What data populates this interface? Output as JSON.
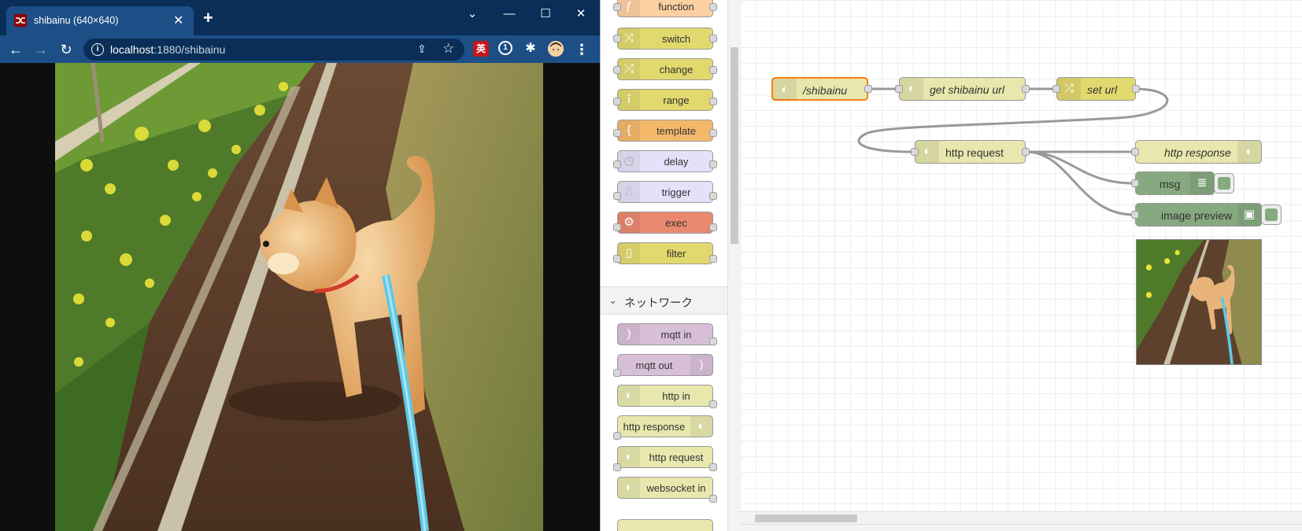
{
  "browser": {
    "tab": {
      "title": "shibainu (640×640)",
      "close": "✕",
      "new_tab": "+"
    },
    "window": {
      "minimize": "—",
      "maximize": "☐",
      "close": "✕",
      "menu": "⌄"
    },
    "toolbar": {
      "back": "←",
      "forward": "→",
      "reload": "↻",
      "url_host": "localhost",
      "url_path": ":1880/shibainu",
      "ext_translate": "英",
      "menu": "⋮"
    },
    "content": {
      "image_subject": "shiba-inu-dog-photo"
    }
  },
  "palette": {
    "category_network": "ネットワーク",
    "nodes_function": [
      {
        "label": "function",
        "icon": "function-icon",
        "color": "#fdd0a2"
      },
      {
        "label": "switch",
        "icon": "switch-icon",
        "color": "#e2d96e"
      },
      {
        "label": "change",
        "icon": "change-icon",
        "color": "#e2d96e"
      },
      {
        "label": "range",
        "icon": "range-icon",
        "color": "#e2d96e"
      },
      {
        "label": "template",
        "icon": "template-icon",
        "color": "#f4b86b"
      },
      {
        "label": "delay",
        "icon": "delay-icon",
        "color": "#e6e0f8"
      },
      {
        "label": "trigger",
        "icon": "trigger-icon",
        "color": "#e6e0f8"
      },
      {
        "label": "exec",
        "icon": "exec-icon",
        "color": "#e9896f"
      },
      {
        "label": "filter",
        "icon": "filter-icon",
        "color": "#e2d96e"
      }
    ],
    "nodes_network": [
      {
        "label": "mqtt in",
        "icon": "mqtt-icon",
        "color": "#d8bfd8"
      },
      {
        "label": "mqtt out",
        "icon": "mqtt-icon",
        "color": "#d8bfd8"
      },
      {
        "label": "http in",
        "icon": "globe-icon",
        "color": "#e7e7ae"
      },
      {
        "label": "http response",
        "icon": "globe-icon",
        "color": "#e7e7ae"
      },
      {
        "label": "http request",
        "icon": "globe-icon",
        "color": "#e7e7ae"
      },
      {
        "label": "websocket in",
        "icon": "globe-icon",
        "color": "#e7e7ae"
      }
    ]
  },
  "flow": {
    "nodes": {
      "http_in": {
        "label": "/shibainu",
        "color": "#e7e7ae"
      },
      "get_url": {
        "label": "get shibainu url",
        "color": "#e7e7ae"
      },
      "set_url": {
        "label": "set url",
        "color": "#e2d96e"
      },
      "http_request": {
        "label": "http request",
        "color": "#e7e7ae"
      },
      "http_response": {
        "label": "http response",
        "color": "#e7e7ae"
      },
      "msg_debug": {
        "label": "msg",
        "color": "#87a980"
      },
      "image_preview": {
        "label": "image preview",
        "color": "#87a980"
      }
    }
  }
}
